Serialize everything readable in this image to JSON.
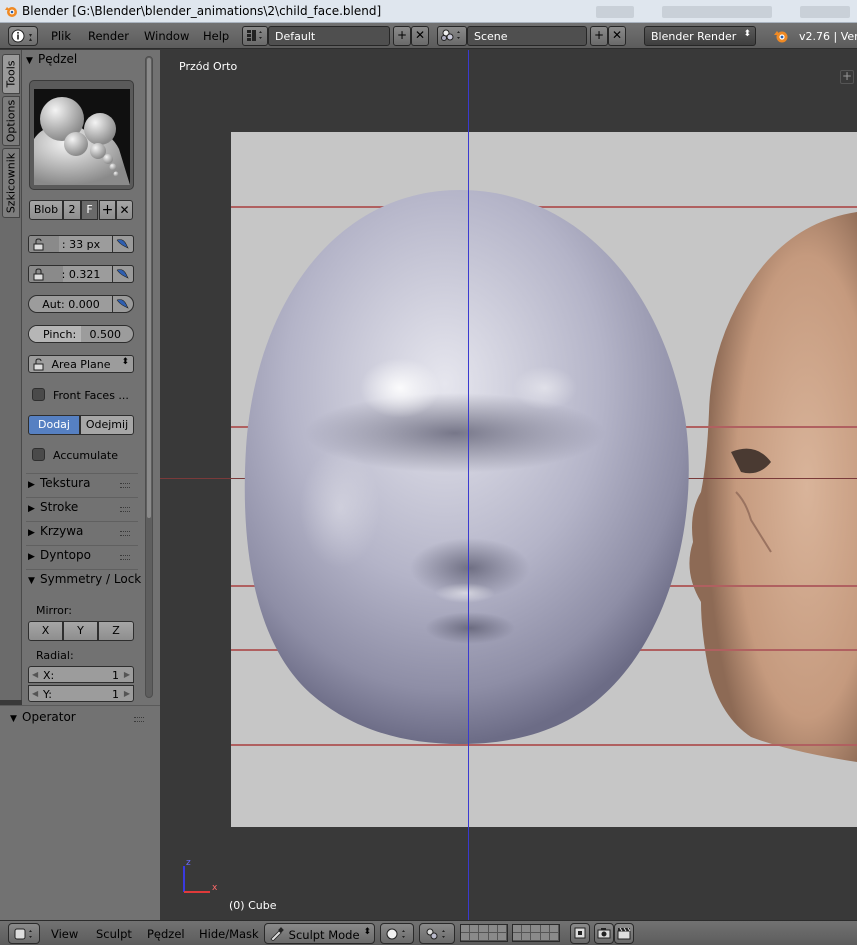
{
  "window": {
    "title": "Blender [G:\\Blender\\blender_animations\\2\\child_face.blend]"
  },
  "info_header": {
    "menus": [
      "Plik",
      "Render",
      "Window",
      "Help"
    ],
    "screen_layout": "Default",
    "scene": "Scene",
    "render_engine": "Blender Render",
    "version": "v2.76 | Ver"
  },
  "tool_tabs": [
    "Tools",
    "Options",
    "Szkicownik"
  ],
  "brush_panel": {
    "header": "Pędzel",
    "brush_name": "Blob",
    "brush_users": "2",
    "fake_user": "F",
    "radius": ": 33 px",
    "strength": ": 0.321",
    "autosmooth": "Aut: 0.000",
    "pinch_label": "Pinch:",
    "pinch_value": "0.500",
    "pinch_fraction": 0.5,
    "sculpt_plane": "Area Plane",
    "front_faces_label": "Front Faces ...",
    "direction": [
      "Dodaj",
      "Odejmij"
    ],
    "active_direction": "Dodaj",
    "accumulate_label": "Accumulate"
  },
  "collapsed_panels": [
    "Tekstura",
    "Stroke",
    "Krzywa",
    "Dyntopo"
  ],
  "symmetry_panel": {
    "header": "Symmetry / Lock",
    "mirror_label": "Mirror:",
    "axes": [
      "X",
      "Y",
      "Z"
    ],
    "radial_label": "Radial:",
    "radial_x_label": "X:",
    "radial_x_value": "1",
    "radial_y_label": "Y:",
    "radial_y_value": "1"
  },
  "operator_panel": {
    "header": "Operator"
  },
  "viewport": {
    "view_name": "Przód Orto",
    "object_info": "(0) Cube",
    "axis_z": "z",
    "axis_x": "x"
  },
  "bottom_header": {
    "menus": [
      "View",
      "Sculpt",
      "Pędzel",
      "Hide/Mask"
    ],
    "mode": "Sculpt Mode"
  },
  "colors": {
    "active_toggle": "#5680c2",
    "viewport_bg": "#393939",
    "panel_bg": "#727272"
  }
}
